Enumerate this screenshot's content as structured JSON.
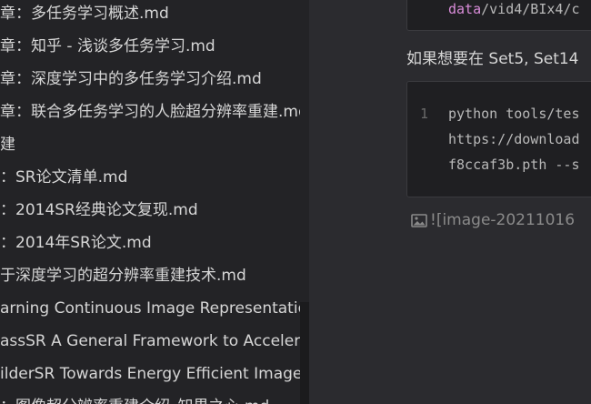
{
  "sidebar": {
    "items": [
      {
        "label": "章：多任务学习概述.md"
      },
      {
        "label": "章：知乎 - 浅谈多任务学习.md"
      },
      {
        "label": "章：深度学习中的多任务学习介绍.md"
      },
      {
        "label": "章：联合多任务学习的人脸超分辨率重建.md"
      },
      {
        "label": "建"
      },
      {
        "label": "：SR论文清单.md"
      },
      {
        "label": "：2014SR经典论文复现.md"
      },
      {
        "label": "：2014年SR论文.md"
      },
      {
        "label": "于深度学习的超分辨率重建技术.md"
      },
      {
        "label": "arning Continuous Image Representation w"
      },
      {
        "label": "assSR A General Framework to Accelerate S"
      },
      {
        "label": "ilderSR Towards Energy Efficient Image Sup"
      },
      {
        "label": "：图像超分辨率重建介绍_知界之心.md"
      }
    ]
  },
  "editor": {
    "top_code": {
      "keyword": "data",
      "rest": "/vid4/BIx4/c"
    },
    "paragraph": "如果想要在 Set5, Set14",
    "code_block": {
      "line_number": "1",
      "lines": [
        "python tools/tes",
        "https://download",
        "f8ccaf3b.pth --s"
      ]
    },
    "image_ref": "![image-20211016"
  },
  "colors": {
    "sidebar_bg": "#232326",
    "editor_bg": "#2b2b2f",
    "code_bg": "#1f1f22",
    "keyword": "#d98cd9"
  },
  "icons": {
    "image_ref": "image-icon"
  }
}
